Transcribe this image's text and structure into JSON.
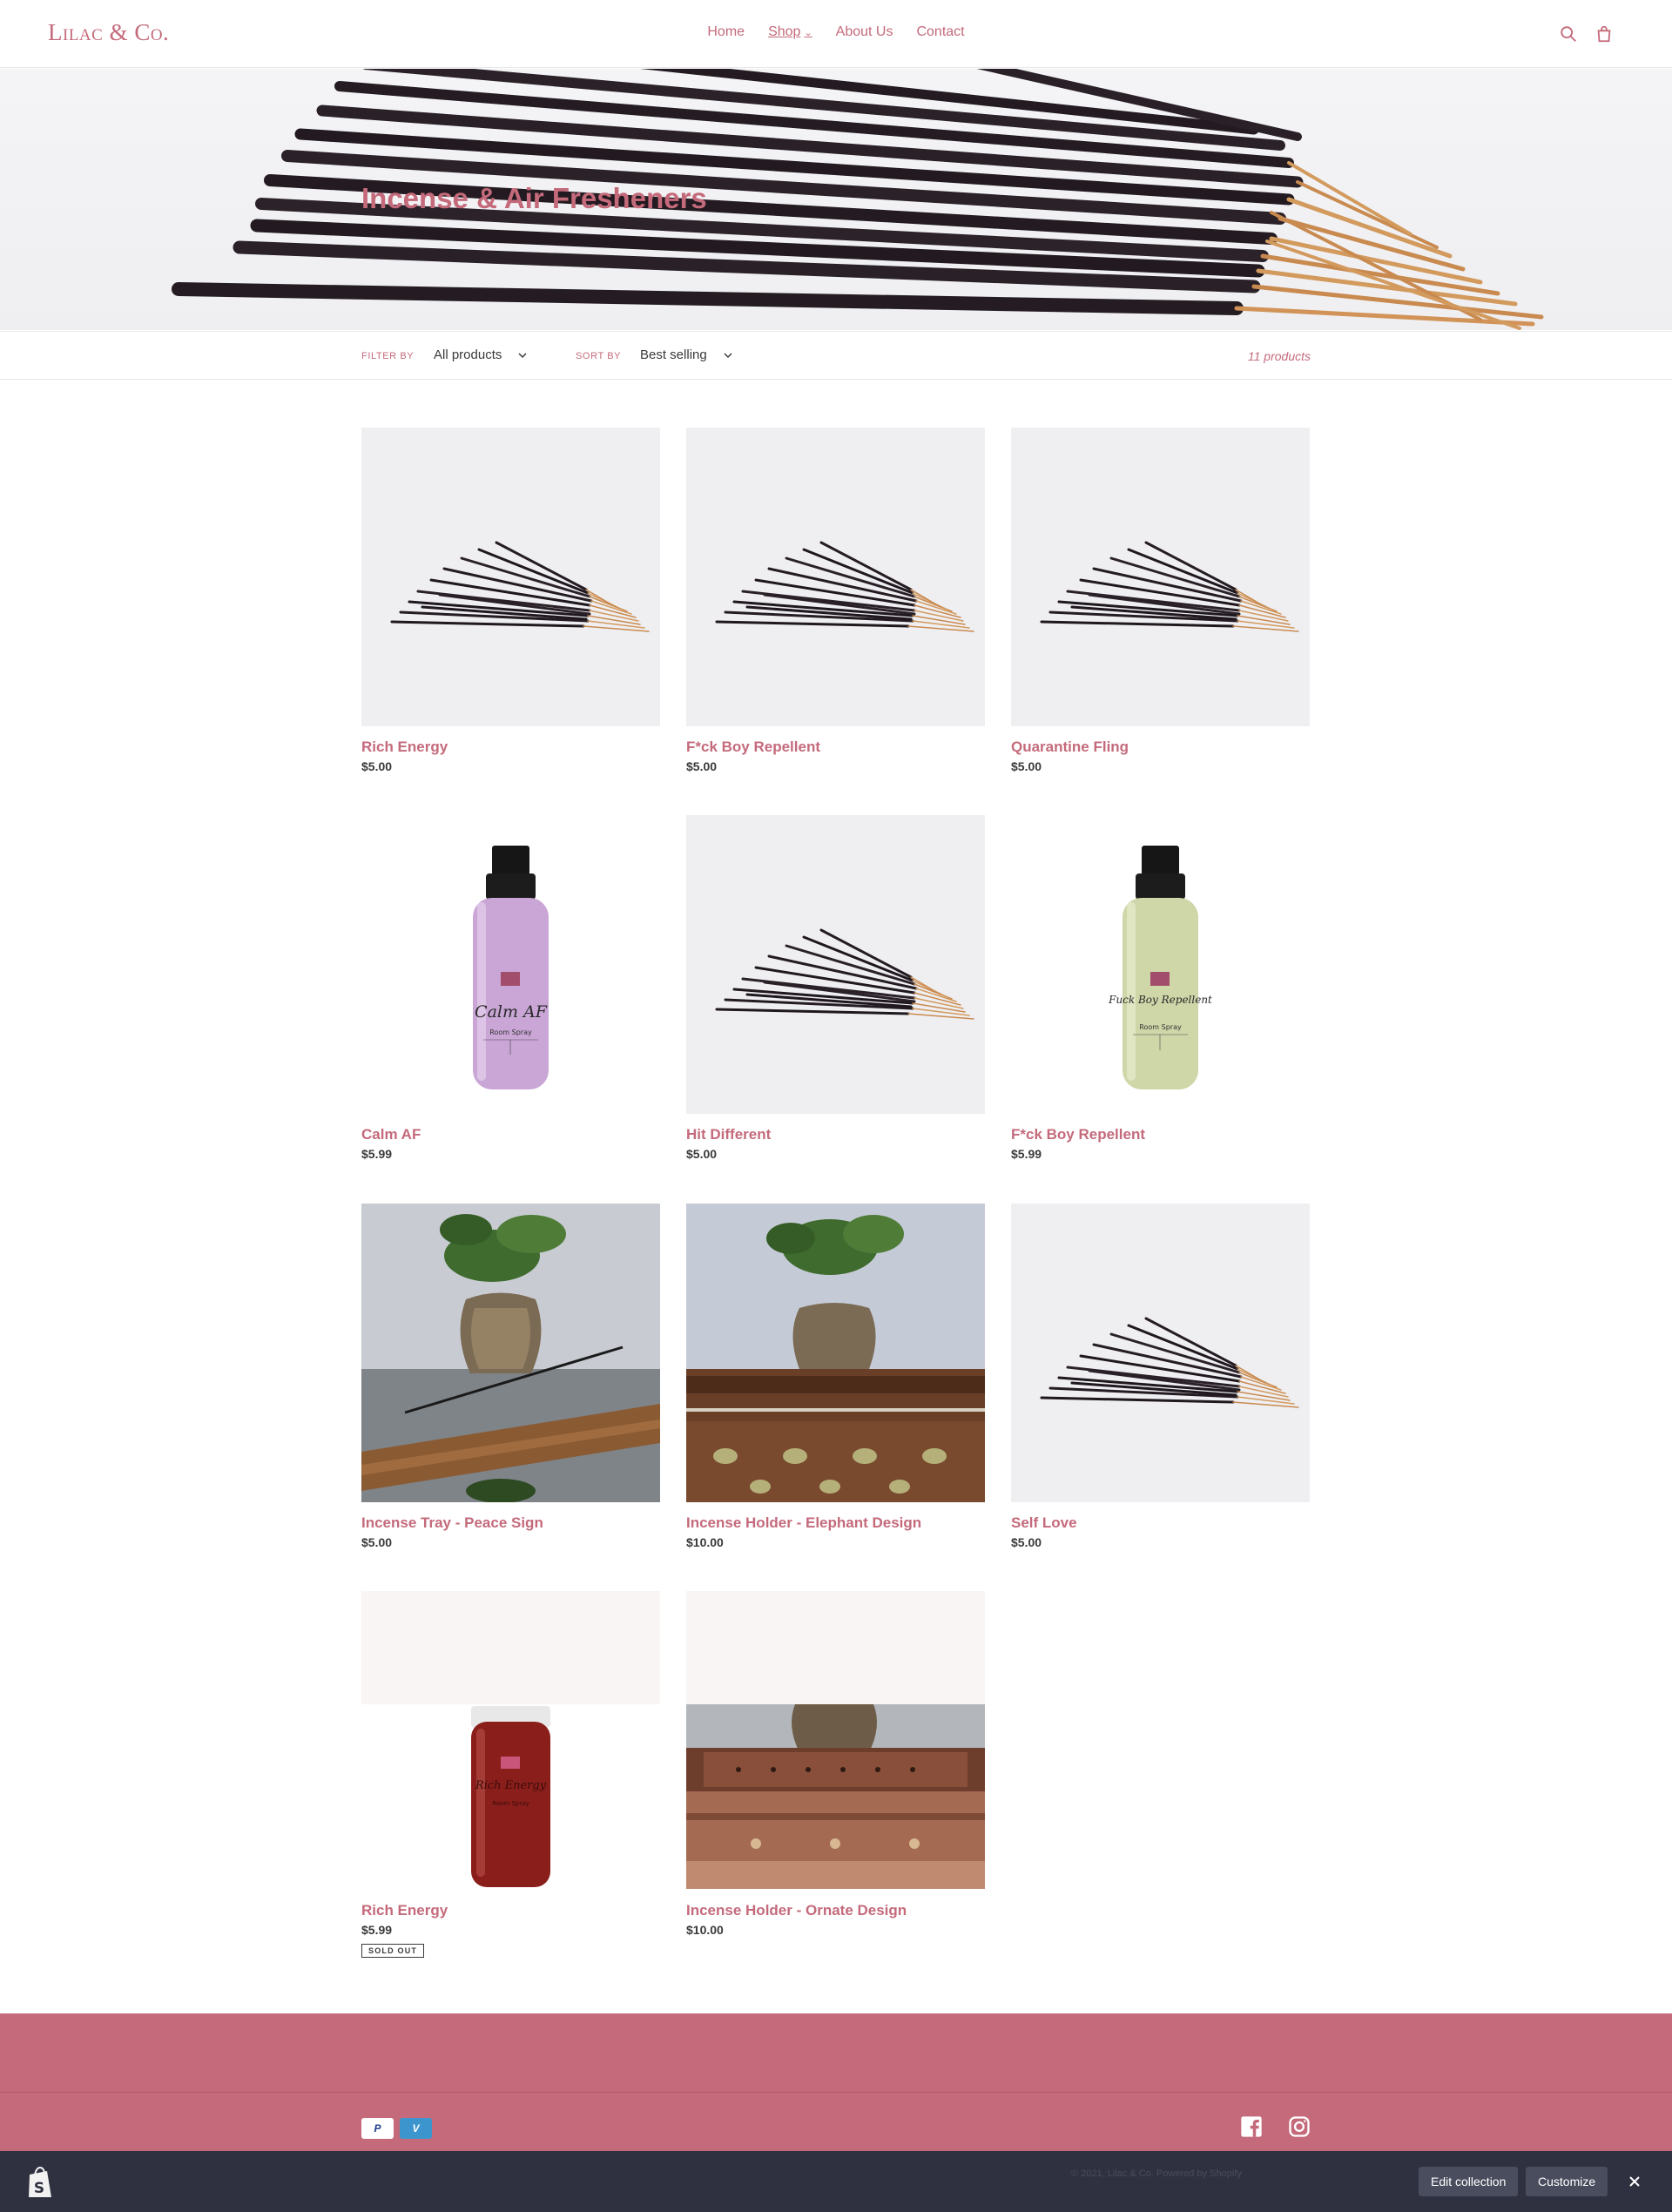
{
  "header": {
    "logo": "Lilac & Co.",
    "nav": [
      {
        "label": "Home"
      },
      {
        "label": "Shop"
      },
      {
        "label": "About Us"
      },
      {
        "label": "Contact"
      }
    ],
    "icons": [
      "search-icon",
      "cart-icon"
    ]
  },
  "hero": {
    "title": "Incense & Air Fresheners"
  },
  "filters": {
    "filter_label": "Filter by",
    "filter_value": "All products",
    "sort_label": "Sort by",
    "sort_value": "Best selling",
    "count": "11 products"
  },
  "products": [
    {
      "title": "Rich Energy",
      "price": "$5.00",
      "image": "incense-sticks"
    },
    {
      "title": "F*ck Boy Repellent",
      "price": "$5.00",
      "image": "incense-sticks"
    },
    {
      "title": "Quarantine Fling",
      "price": "$5.00",
      "image": "incense-sticks"
    },
    {
      "title": "Calm AF",
      "price": "$5.99",
      "image": "room-spray-purple",
      "label_text": "Calm AF",
      "label_sub": "Room Spray"
    },
    {
      "title": "Hit Different",
      "price": "$5.00",
      "image": "incense-sticks"
    },
    {
      "title": "F*ck Boy Repellent",
      "price": "$5.99",
      "image": "room-spray-green",
      "label_text": "Fuck Boy Repellent",
      "label_sub": "Room Spray"
    },
    {
      "title": "Incense Tray - Peace Sign",
      "price": "$5.00",
      "image": "vase-tray"
    },
    {
      "title": "Incense Holder - Elephant Design",
      "price": "$10.00",
      "image": "vase-elephant-box"
    },
    {
      "title": "Self Love",
      "price": "$5.00",
      "image": "incense-sticks"
    },
    {
      "title": "Rich Energy",
      "price": "$5.99",
      "image": "room-spray-red",
      "badge": "Sold out",
      "label_text": "Rich Energy",
      "label_sub": "Room Spray"
    },
    {
      "title": "Incense Holder - Ornate Design",
      "price": "$10.00",
      "image": "ornate-box"
    }
  ],
  "footer": {
    "payment_icons": [
      "paypal-icon",
      "venmo-icon"
    ],
    "social_icons": [
      "facebook-icon",
      "instagram-icon"
    ],
    "colors": {
      "footer_bg": "#c46a7b"
    }
  },
  "admin_bar": {
    "copyright": "© 2021, Lilac & Co. Powered by Shopify",
    "edit_label": "Edit collection",
    "customize_label": "Customize"
  },
  "colors": {
    "accent": "#c46a7b",
    "text": "#3a3a3a",
    "admin_bg": "#2f3140"
  }
}
